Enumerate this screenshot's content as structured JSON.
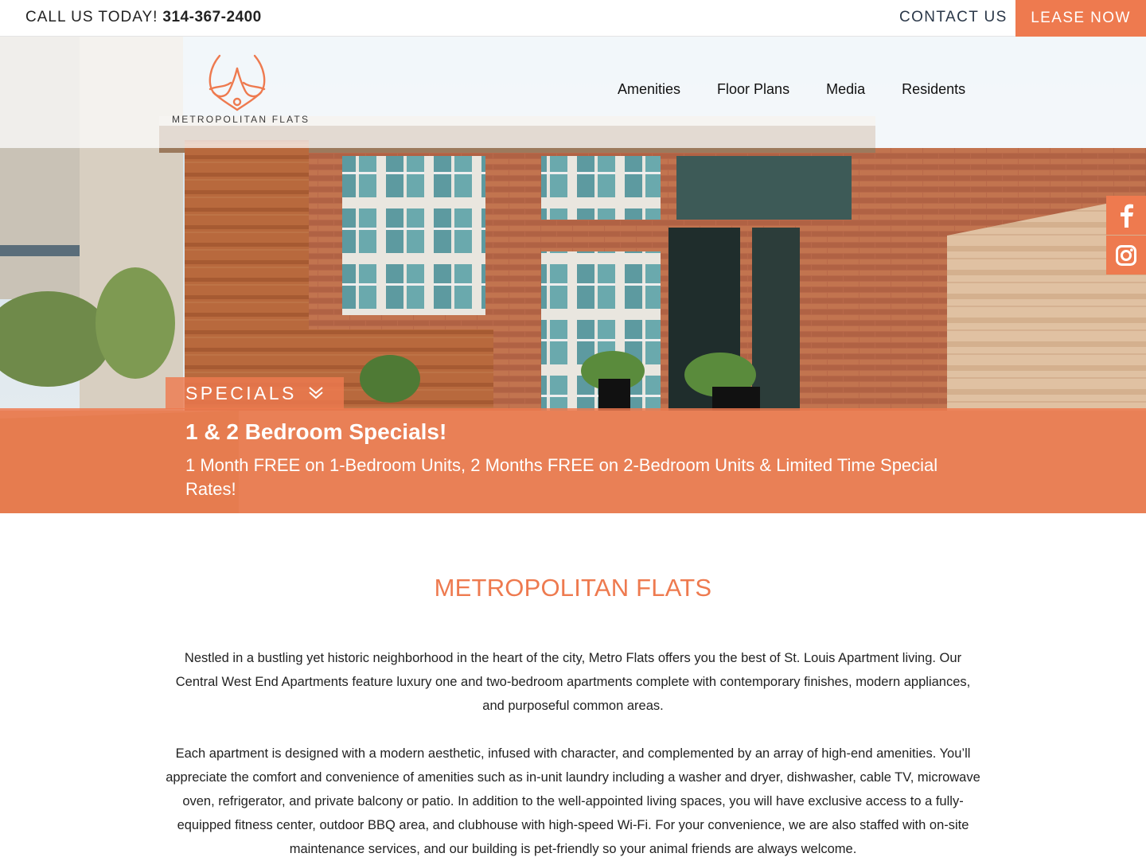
{
  "topbar": {
    "call_label": "CALL US TODAY!",
    "phone": "314-367-2400",
    "contact_label": "CONTACT US",
    "lease_label": "LEASE NOW"
  },
  "brand": {
    "name": "METROPOLITAN FLATS",
    "accent": "#ee7a4f"
  },
  "nav": {
    "items": [
      "Amenities",
      "Floor Plans",
      "Media",
      "Residents"
    ]
  },
  "social": {
    "icons": [
      "facebook-icon",
      "instagram-icon"
    ]
  },
  "specials": {
    "tab_label": "SPECIALS",
    "title": "1 & 2 Bedroom Specials!",
    "text": "1 Month FREE on 1-Bedroom Units, 2 Months FREE on 2-Bedroom Units & Limited Time Special Rates!"
  },
  "main": {
    "heading": "METROPOLITAN FLATS",
    "paragraphs": [
      "Nestled in a bustling yet historic neighborhood in the heart of the city, Metro Flats offers you the best of St. Louis Apartment living. Our Central West End Apartments feature luxury one and two-bedroom apartments complete with contemporary finishes, modern appliances, and purposeful common areas.",
      "Each apartment is designed with a modern aesthetic, infused with character, and complemented by an array of high-end amenities. You’ll appreciate the comfort and convenience of amenities such as in-unit laundry including a washer and dryer, dishwasher, cable TV, microwave oven, refrigerator, and private balcony or patio. In addition to the well-appointed living spaces, you will have exclusive access to a fully-equipped fitness center, outdoor BBQ area, and clubhouse with high-speed Wi-Fi. For your convenience, we are also staffed with on-site maintenance services, and our building is pet-friendly so your animal friends are always welcome."
    ]
  }
}
